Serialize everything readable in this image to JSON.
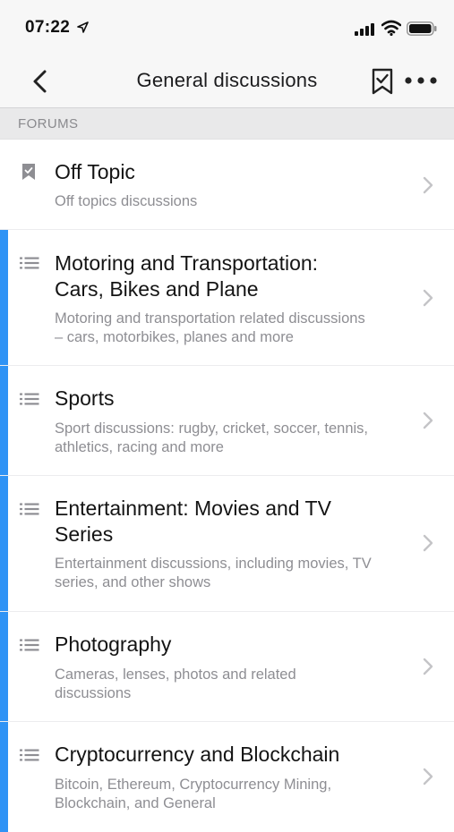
{
  "status": {
    "time": "07:22"
  },
  "nav": {
    "title": "General discussions"
  },
  "section": {
    "label": "FORUMS"
  },
  "forums": [
    {
      "title_lines": [
        "Off Topic"
      ],
      "desc_lines": [
        "Off topics discussions"
      ],
      "icon": "bookmark-filled-icon",
      "unread": false
    },
    {
      "title_lines": [
        "Motoring and Transportation:",
        "Cars, Bikes and Plane"
      ],
      "desc_lines": [
        "Motoring and transportation related discussions",
        "– cars, motorbikes, planes and more"
      ],
      "icon": "list-icon",
      "unread": true
    },
    {
      "title_lines": [
        "Sports"
      ],
      "desc_lines": [
        "Sport discussions: rugby, cricket, soccer, tennis,",
        "athletics, racing and more"
      ],
      "icon": "list-icon",
      "unread": true
    },
    {
      "title_lines": [
        "Entertainment: Movies and TV",
        "Series"
      ],
      "desc_lines": [
        "Entertainment discussions, including movies, TV",
        "series, and other shows"
      ],
      "icon": "list-icon",
      "unread": true
    },
    {
      "title_lines": [
        "Photography"
      ],
      "desc_lines": [
        "Cameras, lenses, photos and related",
        "discussions"
      ],
      "icon": "list-icon",
      "unread": true
    },
    {
      "title_lines": [
        "Cryptocurrency and Blockchain"
      ],
      "desc_lines": [
        "Bitcoin, Ethereum, Cryptocurrency Mining,",
        "Blockchain, and General"
      ],
      "icon": "list-icon",
      "unread": true
    }
  ],
  "colors": {
    "accent": "#2f93f5",
    "section_bg": "#e9e9ea",
    "secondary_text": "#8e8e93"
  }
}
